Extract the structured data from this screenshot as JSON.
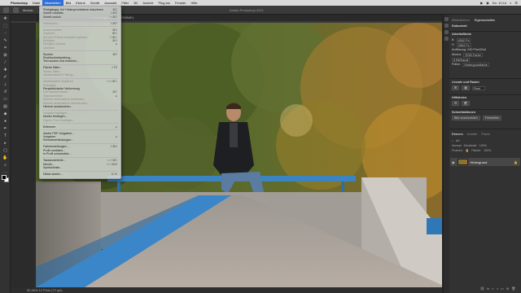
{
  "menubar": {
    "app": "Photoshop",
    "items": [
      "Datei",
      "Bearbeiten",
      "Bild",
      "Ebene",
      "Schrift",
      "Auswahl",
      "Filter",
      "3D",
      "Ansicht",
      "Plug-ins",
      "Fenster",
      "Hilfe"
    ],
    "active_index": 1,
    "status": [
      "▶",
      "◉",
      "Do. 10:14",
      "⌕",
      "☰"
    ]
  },
  "options_bar": {
    "window_title": "Adobe Photoshop 2021",
    "mode_label": "Modus:",
    "mode_value": "Normal",
    "strength_label": "Stärke:",
    "strength_value": "50%"
  },
  "document": {
    "tab_title": "Portrait.jpg @ 50% (RGB/8*)",
    "status": "50,46%   12 Pixel (72 ppi)"
  },
  "edit_menu": {
    "items": [
      {
        "label": "Rückgängig: Auf Hintergrundebene reduzieren",
        "shortcut": "⌘Z",
        "disabled": false
      },
      {
        "label": "Schritt vorwärts",
        "shortcut": "⇧⌘Z",
        "disabled": false
      },
      {
        "label": "Schritt zurück",
        "shortcut": "⌥⌘Z",
        "disabled": false
      },
      {
        "sep": true
      },
      {
        "label": "Verblassen...",
        "shortcut": "⇧⌘F",
        "disabled": true
      },
      {
        "sep": true
      },
      {
        "label": "Ausschneiden",
        "shortcut": "⌘X",
        "disabled": true
      },
      {
        "label": "Kopieren",
        "shortcut": "⌘C",
        "disabled": true
      },
      {
        "label": "Auf eine Ebene reduziert kopieren",
        "shortcut": "⇧⌘C",
        "disabled": true
      },
      {
        "label": "Einfügen",
        "shortcut": "⌘V",
        "disabled": true
      },
      {
        "label": "Einfügen Spezial",
        "shortcut": "▸",
        "disabled": true
      },
      {
        "label": "Löschen",
        "shortcut": "",
        "disabled": true
      },
      {
        "sep": true
      },
      {
        "label": "Suchen",
        "shortcut": "⌘F",
        "disabled": false
      },
      {
        "label": "Rechtschreibprüfung...",
        "shortcut": "",
        "disabled": false
      },
      {
        "label": "Text suchen und ersetzen...",
        "shortcut": "",
        "disabled": false
      },
      {
        "sep": true
      },
      {
        "label": "Fläche füllen...",
        "shortcut": "⇧F5",
        "disabled": false
      },
      {
        "label": "Kontur füllen...",
        "shortcut": "",
        "disabled": true
      },
      {
        "label": "Inhaltsbasierte Füllung...",
        "shortcut": "",
        "disabled": true
      },
      {
        "sep": true
      },
      {
        "label": "Inhaltsbasiert skalieren",
        "shortcut": "⌥⇧⌘C",
        "disabled": true
      },
      {
        "label": "Formgitter",
        "shortcut": "",
        "disabled": true
      },
      {
        "label": "Perspektivische Verformung",
        "shortcut": "",
        "disabled": false
      },
      {
        "label": "Frei transformieren",
        "shortcut": "⌘T",
        "disabled": true
      },
      {
        "label": "Transformieren",
        "shortcut": "▸",
        "disabled": true
      },
      {
        "label": "Ebenen automatisch ausrichten...",
        "shortcut": "",
        "disabled": true
      },
      {
        "label": "Ebenen automatisch überblenden...",
        "shortcut": "",
        "disabled": true
      },
      {
        "label": "Himmel austauschen...",
        "shortcut": "",
        "disabled": false
      },
      {
        "sep": true
      },
      {
        "label": "Vorgabe festlegen...",
        "shortcut": "",
        "disabled": true
      },
      {
        "label": "Muster festlegen...",
        "shortcut": "",
        "disabled": false
      },
      {
        "label": "Eigene Form festlegen...",
        "shortcut": "",
        "disabled": true
      },
      {
        "sep": true
      },
      {
        "label": "Entleeren",
        "shortcut": "▸",
        "disabled": false
      },
      {
        "sep": true
      },
      {
        "label": "Adobe PDF-Vorgaben...",
        "shortcut": "",
        "disabled": false
      },
      {
        "label": "Vorgaben",
        "shortcut": "▸",
        "disabled": false
      },
      {
        "label": "Remoteverbindungen...",
        "shortcut": "",
        "disabled": false
      },
      {
        "sep": true
      },
      {
        "label": "Farbeinstellungen...",
        "shortcut": "⇧⌘K",
        "disabled": false
      },
      {
        "label": "Profil zuweisen...",
        "shortcut": "",
        "disabled": false
      },
      {
        "label": "In Profil umwandeln...",
        "shortcut": "",
        "disabled": false
      },
      {
        "sep": true
      },
      {
        "label": "Tastaturbefehle...",
        "shortcut": "⌥⇧⌘K",
        "disabled": false
      },
      {
        "label": "Menüs...",
        "shortcut": "⌥⇧⌘M",
        "disabled": false
      },
      {
        "label": "Symbolleiste...",
        "shortcut": "",
        "disabled": false
      },
      {
        "sep": true
      },
      {
        "label": "Diktat starten...",
        "shortcut": "fn fn",
        "disabled": false
      }
    ]
  },
  "panels": {
    "tabs": [
      "Bibliotheken",
      "Eigenschaften"
    ],
    "active_tab": 1,
    "document_label": "Dokument",
    "canvas_header": "Arbeitsfläche",
    "width_label": "B",
    "width_value": "4592 Px",
    "height_label": "H",
    "height_value": "3064 Px",
    "resolution": "Auflösung: 240 Pixel/Zoll",
    "mode_label": "Modus",
    "mode_value": "RGB-Farbe",
    "depth_value": "8 Bit/Kanal",
    "fill_label": "Füllen",
    "fill_value": "Hintergrundfarbe",
    "rulers_header": "Lineale und Raster",
    "rulers_unit": "Pixel",
    "guides_header": "Hilfslinien",
    "quick_actions_header": "Schnellaktionen",
    "qa_button_1": "Bild zuschneiden",
    "qa_button_2": "Freistellen",
    "layers_tabs": [
      "Ebenen",
      "Kanäle",
      "Pfade"
    ],
    "layers_active": 0,
    "kind_label": "Art",
    "blend_mode": "Normal",
    "opacity_label": "Deckkraft:",
    "opacity_value": "100%",
    "lock_label": "Fixieren:",
    "fill_opacity_label": "Fläche:",
    "fill_opacity_value": "100%",
    "layer_name": "Hintergrund"
  }
}
